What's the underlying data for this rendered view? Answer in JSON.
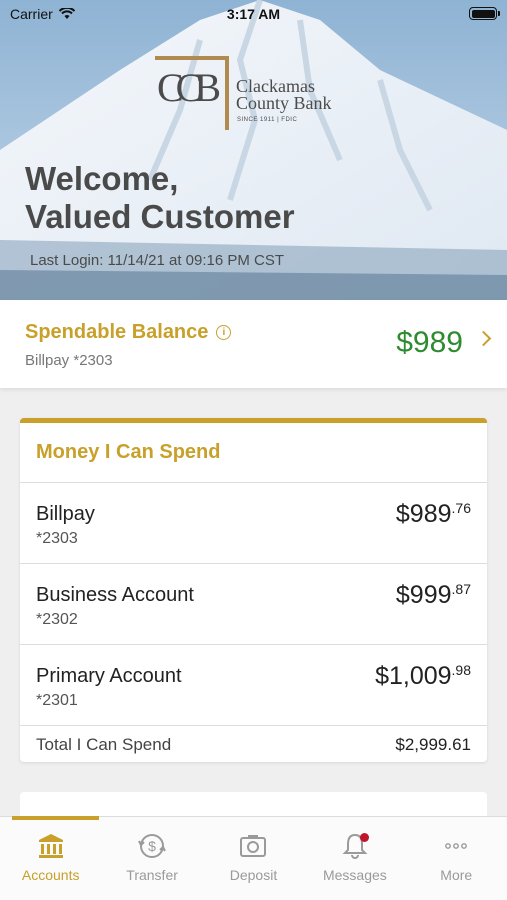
{
  "status_bar": {
    "carrier": "Carrier",
    "time": "3:17 AM"
  },
  "hero": {
    "logo_monogram": "CCB",
    "bank_name_line1": "Clackamas",
    "bank_name_line2": "County Bank",
    "since": "SINCE 1911 | FDIC",
    "welcome_line1": "Welcome,",
    "welcome_line2": "Valued Customer",
    "last_login": "Last Login: 11/14/21 at 09:16 PM CST"
  },
  "spendable": {
    "title": "Spendable Balance",
    "info_icon": "i",
    "account": "Billpay *2303",
    "amount": "$989"
  },
  "money_card": {
    "title": "Money I Can Spend",
    "accounts": [
      {
        "name": "Billpay",
        "number": "*2303",
        "balance_main": "$989",
        "balance_cents": ".76"
      },
      {
        "name": "Business Account",
        "number": "*2302",
        "balance_main": "$999",
        "balance_cents": ".87"
      },
      {
        "name": "Primary Account",
        "number": "*2301",
        "balance_main": "$1,009",
        "balance_cents": ".98"
      }
    ],
    "total_label": "Total I Can Spend",
    "total_value": "$2,999.61"
  },
  "tabs": [
    {
      "label": "Accounts",
      "icon": "bank-icon",
      "active": true
    },
    {
      "label": "Transfer",
      "icon": "transfer-icon",
      "active": false
    },
    {
      "label": "Deposit",
      "icon": "camera-icon",
      "active": false
    },
    {
      "label": "Messages",
      "icon": "bell-icon",
      "active": false
    },
    {
      "label": "More",
      "icon": "more-dots-icon",
      "active": false
    }
  ],
  "colors": {
    "accent": "#c8a02a",
    "positive": "#2e8b2e",
    "badge": "#c0152b"
  }
}
